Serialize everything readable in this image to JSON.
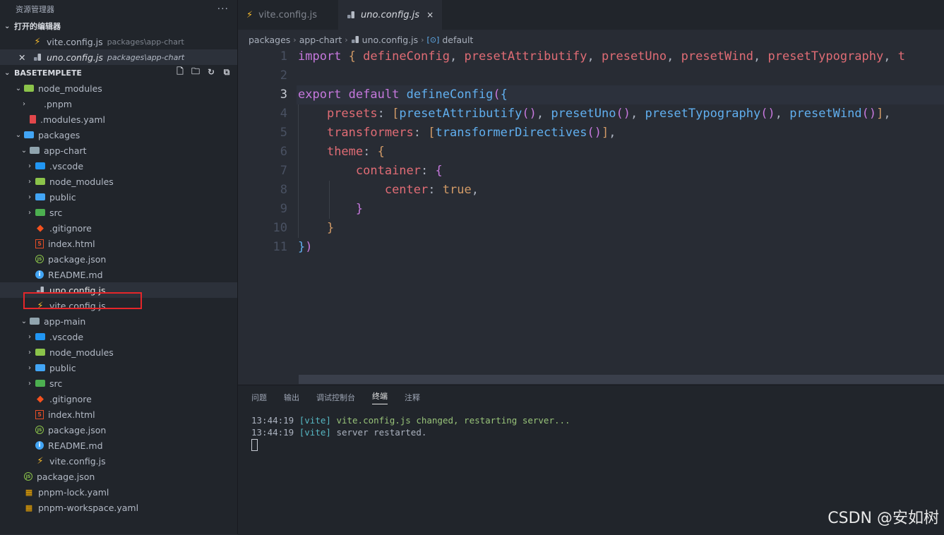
{
  "explorer": {
    "title": "资源管理器",
    "more": "···",
    "open_editors_label": "打开的编辑器",
    "open_editors": [
      {
        "name": "vite.config.js",
        "path": "packages\\app-chart"
      },
      {
        "name": "uno.config.js",
        "path": "packages\\app-chart"
      }
    ],
    "workspace_label": "BASETEMPLETE",
    "tree": [
      "node_modules",
      ".pnpm",
      ".modules.yaml",
      "packages",
      "app-chart",
      ".vscode",
      "node_modules",
      "public",
      "src",
      ".gitignore",
      "index.html",
      "package.json",
      "README.md",
      "uno.config.js",
      "vite.config.js",
      "app-main",
      ".vscode",
      "node_modules",
      "public",
      "src",
      ".gitignore",
      "index.html",
      "package.json",
      "README.md",
      "vite.config.js",
      "package.json",
      "pnpm-lock.yaml",
      "pnpm-workspace.yaml"
    ]
  },
  "tabs": [
    {
      "label": "vite.config.js"
    },
    {
      "label": "uno.config.js",
      "close": "×"
    }
  ],
  "breadcrumb": [
    "packages",
    "app-chart",
    "uno.config.js",
    "default"
  ],
  "code_lines": [
    "import { defineConfig, presetAttributify, presetUno, presetWind, presetTypography, t",
    "",
    "export default defineConfig({",
    "    presets: [presetAttributify(), presetUno(), presetTypography(), presetWind()],",
    "    transformers: [transformerDirectives()],",
    "    theme: {",
    "        container: {",
    "            center: true,",
    "        }",
    "    }",
    "})"
  ],
  "line_numbers": [
    "1",
    "2",
    "3",
    "4",
    "5",
    "6",
    "7",
    "8",
    "9",
    "10",
    "11"
  ],
  "panel": {
    "tabs": [
      "问题",
      "输出",
      "调试控制台",
      "终端",
      "注释"
    ],
    "active_tab": "终端",
    "terminal": [
      {
        "time": "13:44:19",
        "tag": "[vite]",
        "msg": "vite.config.js changed, restarting server..."
      },
      {
        "time": "13:44:19",
        "tag": "[vite]",
        "msg": "server restarted."
      }
    ]
  },
  "watermark": "CSDN @安如树",
  "colors": {
    "keyword": "#c678dd",
    "function": "#61afef",
    "identifier": "#e06c75",
    "bracket": "#d19a66",
    "highlight_box": "#e5262a"
  }
}
